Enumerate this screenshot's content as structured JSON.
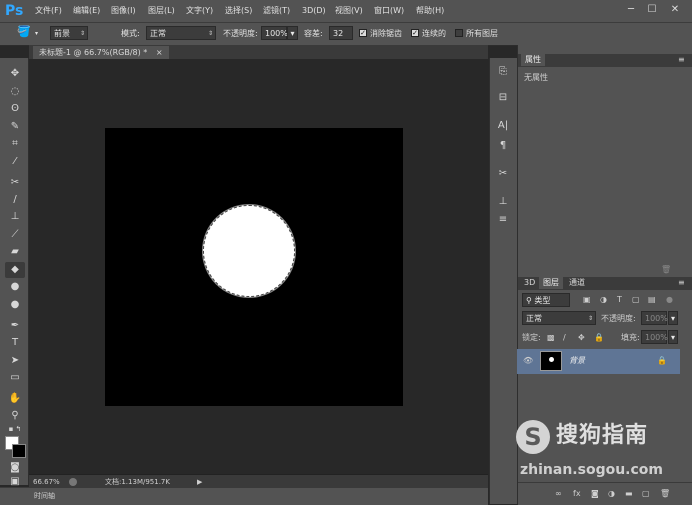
{
  "app": {
    "logo": "Ps"
  },
  "menu": [
    "文件(F)",
    "编辑(E)",
    "图像(I)",
    "图层(L)",
    "文字(Y)",
    "选择(S)",
    "滤镜(T)",
    "3D(D)",
    "视图(V)",
    "窗口(W)",
    "帮助(H)"
  ],
  "window_controls": {
    "minimize": "─",
    "restore": "☐",
    "close": "✕"
  },
  "options": {
    "fill_source": "前景",
    "mode_label": "模式:",
    "mode_value": "正常",
    "opacity_label": "不透明度:",
    "opacity_value": "100%",
    "tolerance_label": "容差:",
    "tolerance_value": "32",
    "antialias_label": "消除锯齿",
    "contiguous_label": "连续的",
    "all_layers_label": "所有图层"
  },
  "document_tab": {
    "title": "未标题-1 @ 66.7%(RGB/8) *",
    "close": "×"
  },
  "status": {
    "zoom": "66.67%",
    "doc_info": "文档:1.13M/951.7K"
  },
  "timeline_label": "时间轴",
  "properties_panel": {
    "tab": "属性",
    "content": "无属性"
  },
  "layers_panel": {
    "tabs": [
      "3D",
      "图层",
      "通道"
    ],
    "filter_kind": "类型",
    "blend_mode": "正常",
    "opacity_label": "不透明度:",
    "opacity_value": "100%",
    "lock_label": "锁定:",
    "fill_label": "填充:",
    "fill_value": "100%",
    "layers": [
      {
        "name": "背景",
        "visible": true,
        "locked": true
      }
    ]
  },
  "watermark": {
    "logo_letter": "S",
    "title": "搜狗指南",
    "url": "zhinan.sogou.com"
  },
  "colors": {
    "ui_bg": "#535353",
    "canvas_bg": "#282828",
    "layer_selected": "#5f7595",
    "accent": "#31a8ff"
  }
}
